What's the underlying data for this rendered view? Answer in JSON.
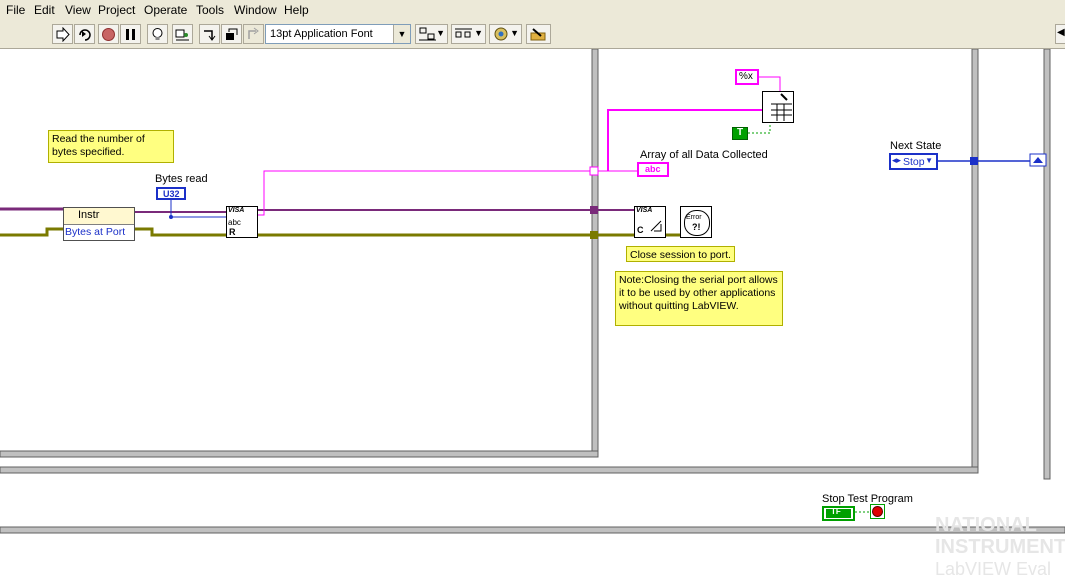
{
  "menu": [
    "File",
    "Edit",
    "View",
    "Project",
    "Operate",
    "Tools",
    "Window",
    "Help"
  ],
  "toolbar": {
    "font_selector": "13pt Application Font"
  },
  "diagram": {
    "comment_read": "Read the number of bytes specified.",
    "label_bytes_read": "Bytes read",
    "u32_label": "U32",
    "instr_label": "Instr",
    "bytes_at_port_label": "Bytes at Port",
    "label_array_collected": "Array of all Data Collected",
    "abc_label": "abc",
    "format_label": "%x",
    "true_constant": "T",
    "comment_close": "Close session to port.",
    "comment_note": "Note:Closing the serial port allows it to be used by other applications without quitting LabVIEW.",
    "label_next_state": "Next State",
    "next_state_value": "Stop",
    "label_stop_test": "Stop Test Program",
    "tf_label": "TF",
    "visa_label": "VISA",
    "error_label": "Error",
    "watermark_line1": "NATIONAL",
    "watermark_line2": "INSTRUMENTS",
    "watermark_line3": "LabVIEW Eval"
  }
}
